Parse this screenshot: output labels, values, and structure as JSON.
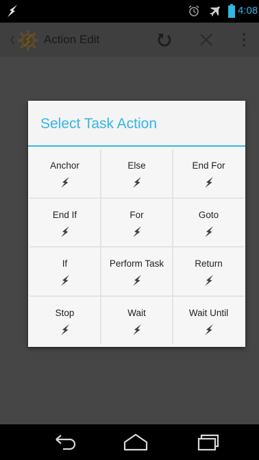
{
  "status_bar": {
    "time": "4:08",
    "icons": [
      "tasker-bolt-icon",
      "alarm-icon",
      "airplane-mode-icon",
      "battery-icon"
    ],
    "accent_color": "#33b5e5"
  },
  "action_bar": {
    "title": "Action Edit",
    "icons": [
      "up-chevron-icon",
      "tasker-app-icon",
      "undo-icon",
      "close-icon",
      "overflow-menu-icon"
    ]
  },
  "dialog": {
    "title": "Select Task Action",
    "title_color": "#33b5e5",
    "actions": [
      {
        "label": "Anchor",
        "icon": "bolt-icon"
      },
      {
        "label": "Else",
        "icon": "bolt-icon"
      },
      {
        "label": "End For",
        "icon": "bolt-icon"
      },
      {
        "label": "End If",
        "icon": "bolt-icon"
      },
      {
        "label": "For",
        "icon": "bolt-icon"
      },
      {
        "label": "Goto",
        "icon": "bolt-icon"
      },
      {
        "label": "If",
        "icon": "bolt-icon"
      },
      {
        "label": "Perform Task",
        "icon": "bolt-icon"
      },
      {
        "label": "Return",
        "icon": "bolt-icon"
      },
      {
        "label": "Stop",
        "icon": "bolt-icon"
      },
      {
        "label": "Wait",
        "icon": "bolt-icon"
      },
      {
        "label": "Wait Until",
        "icon": "bolt-icon"
      }
    ]
  },
  "nav_bar": {
    "buttons": [
      "back-icon",
      "home-icon",
      "recent-apps-icon"
    ]
  }
}
